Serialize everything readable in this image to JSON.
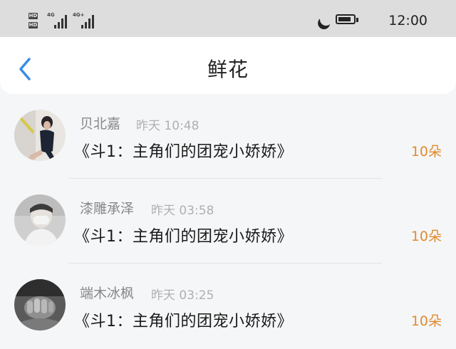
{
  "status_bar": {
    "hd_label": "HD",
    "net_label": "4G",
    "net_label_2": "4G+",
    "time": "12:00"
  },
  "header": {
    "title": "鲜花"
  },
  "items": [
    {
      "user": "贝北嘉",
      "time": "昨天 10:48",
      "book": "《斗1：主角们的团宠小娇娇》",
      "quantity": "10朵"
    },
    {
      "user": "漆雕承泽",
      "time": "昨天 03:58",
      "book": "《斗1：主角们的团宠小娇娇》",
      "quantity": "10朵"
    },
    {
      "user": "端木冰枫",
      "time": "昨天 03:25",
      "book": "《斗1：主角们的团宠小娇娇》",
      "quantity": "10朵"
    }
  ],
  "colors": {
    "accent_quantity": "#e08b2e",
    "back_icon": "#3a8ee6"
  }
}
